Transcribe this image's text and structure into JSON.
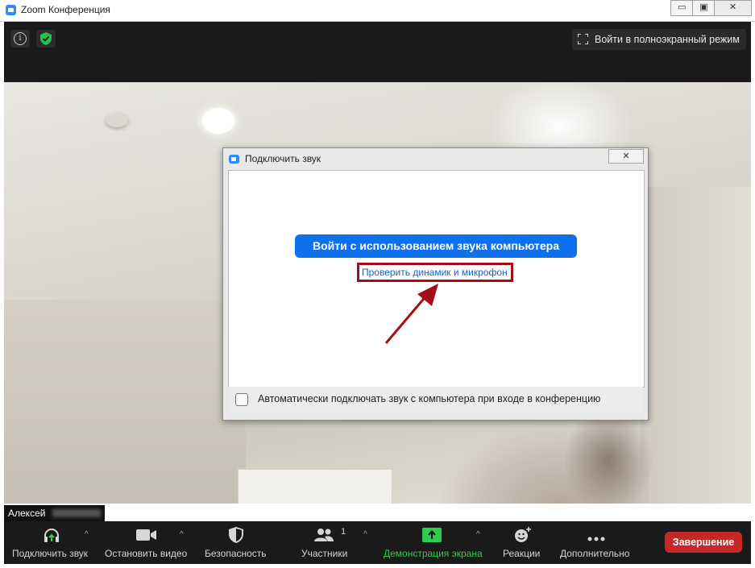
{
  "window": {
    "title": "Zoom Конференция",
    "controls": {
      "minimize": "▭",
      "maximize": "▣",
      "close": "✕"
    }
  },
  "topbar": {
    "info_icon": "info-icon",
    "security_icon": "shield-check-icon",
    "fullscreen_label": "Войти в полноэкранный режим"
  },
  "video": {
    "participant_name": "Алексей"
  },
  "dialog": {
    "title": "Подключить звук",
    "close_glyph": "✕",
    "join_button_label": "Войти с использованием звука компьютера",
    "test_link_label": "Проверить динамик и микрофон",
    "auto_join_label": "Автоматически подключать звук с компьютера при входе в конференцию",
    "auto_join_checked": false,
    "highlight_color": "#a30d15"
  },
  "toolbar": {
    "items": [
      {
        "label": "Подключить звук",
        "icon": "headphones-icon"
      },
      {
        "label": "Остановить видео",
        "icon": "video-camera-icon"
      },
      {
        "label": "Безопасность",
        "icon": "shield-icon"
      },
      {
        "label": "Участники",
        "icon": "participants-icon",
        "count": "1"
      },
      {
        "label": "Демонстрация экрана",
        "icon": "share-screen-icon"
      },
      {
        "label": "Реакции",
        "icon": "reactions-icon"
      },
      {
        "label": "Дополнительно",
        "icon": "more-icon"
      }
    ],
    "caret": "^",
    "end_label": "Завершение",
    "accent_green": "#2ecc50",
    "end_color": "#c62828"
  }
}
